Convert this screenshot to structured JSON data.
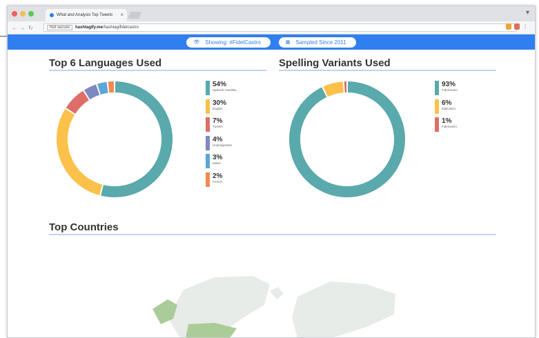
{
  "browser": {
    "tab_title": "What and Analysis Top Tweets",
    "url_secure": "Not secure",
    "url_domain": "hashtagify.me",
    "url_path": "/hashtag/fidelcastro"
  },
  "header": {
    "showing": "Showing: #FidelCastro",
    "sampled": "Sampled Since 2011"
  },
  "colors": {
    "teal": "#5aa9ac",
    "yellow": "#fcc14a",
    "red": "#df6d68",
    "purple": "#7f88c1",
    "blue": "#5aa6d8",
    "orange": "#f08a52",
    "accent": "#2f7ff0",
    "map_green": "#a9cc99",
    "map_land": "#e8ece8"
  },
  "languages": {
    "title": "Top 6 Languages Used",
    "items": [
      {
        "pct": "54%",
        "name": "Spanish Castilian",
        "value": 54,
        "color": "#5aa9ac"
      },
      {
        "pct": "30%",
        "name": "English",
        "value": 30,
        "color": "#fcc14a"
      },
      {
        "pct": "7%",
        "name": "Turkish",
        "value": 7,
        "color": "#df6d68"
      },
      {
        "pct": "4%",
        "name": "Undesignated",
        "value": 4,
        "color": "#7f88c1"
      },
      {
        "pct": "3%",
        "name": "Italian",
        "value": 3,
        "color": "#5aa6d8"
      },
      {
        "pct": "2%",
        "name": "French",
        "value": 2,
        "color": "#f08a52"
      }
    ]
  },
  "spelling": {
    "title": "Spelling Variants Used",
    "items": [
      {
        "pct": "93%",
        "name": "FidelCastro",
        "value": 93,
        "color": "#5aa9ac"
      },
      {
        "pct": "6%",
        "name": "fidelcastro",
        "value": 6,
        "color": "#fcc14a"
      },
      {
        "pct": "1%",
        "name": "Fidelcastro",
        "value": 1,
        "color": "#df6d68"
      }
    ]
  },
  "countries": {
    "title": "Top Countries"
  }
}
